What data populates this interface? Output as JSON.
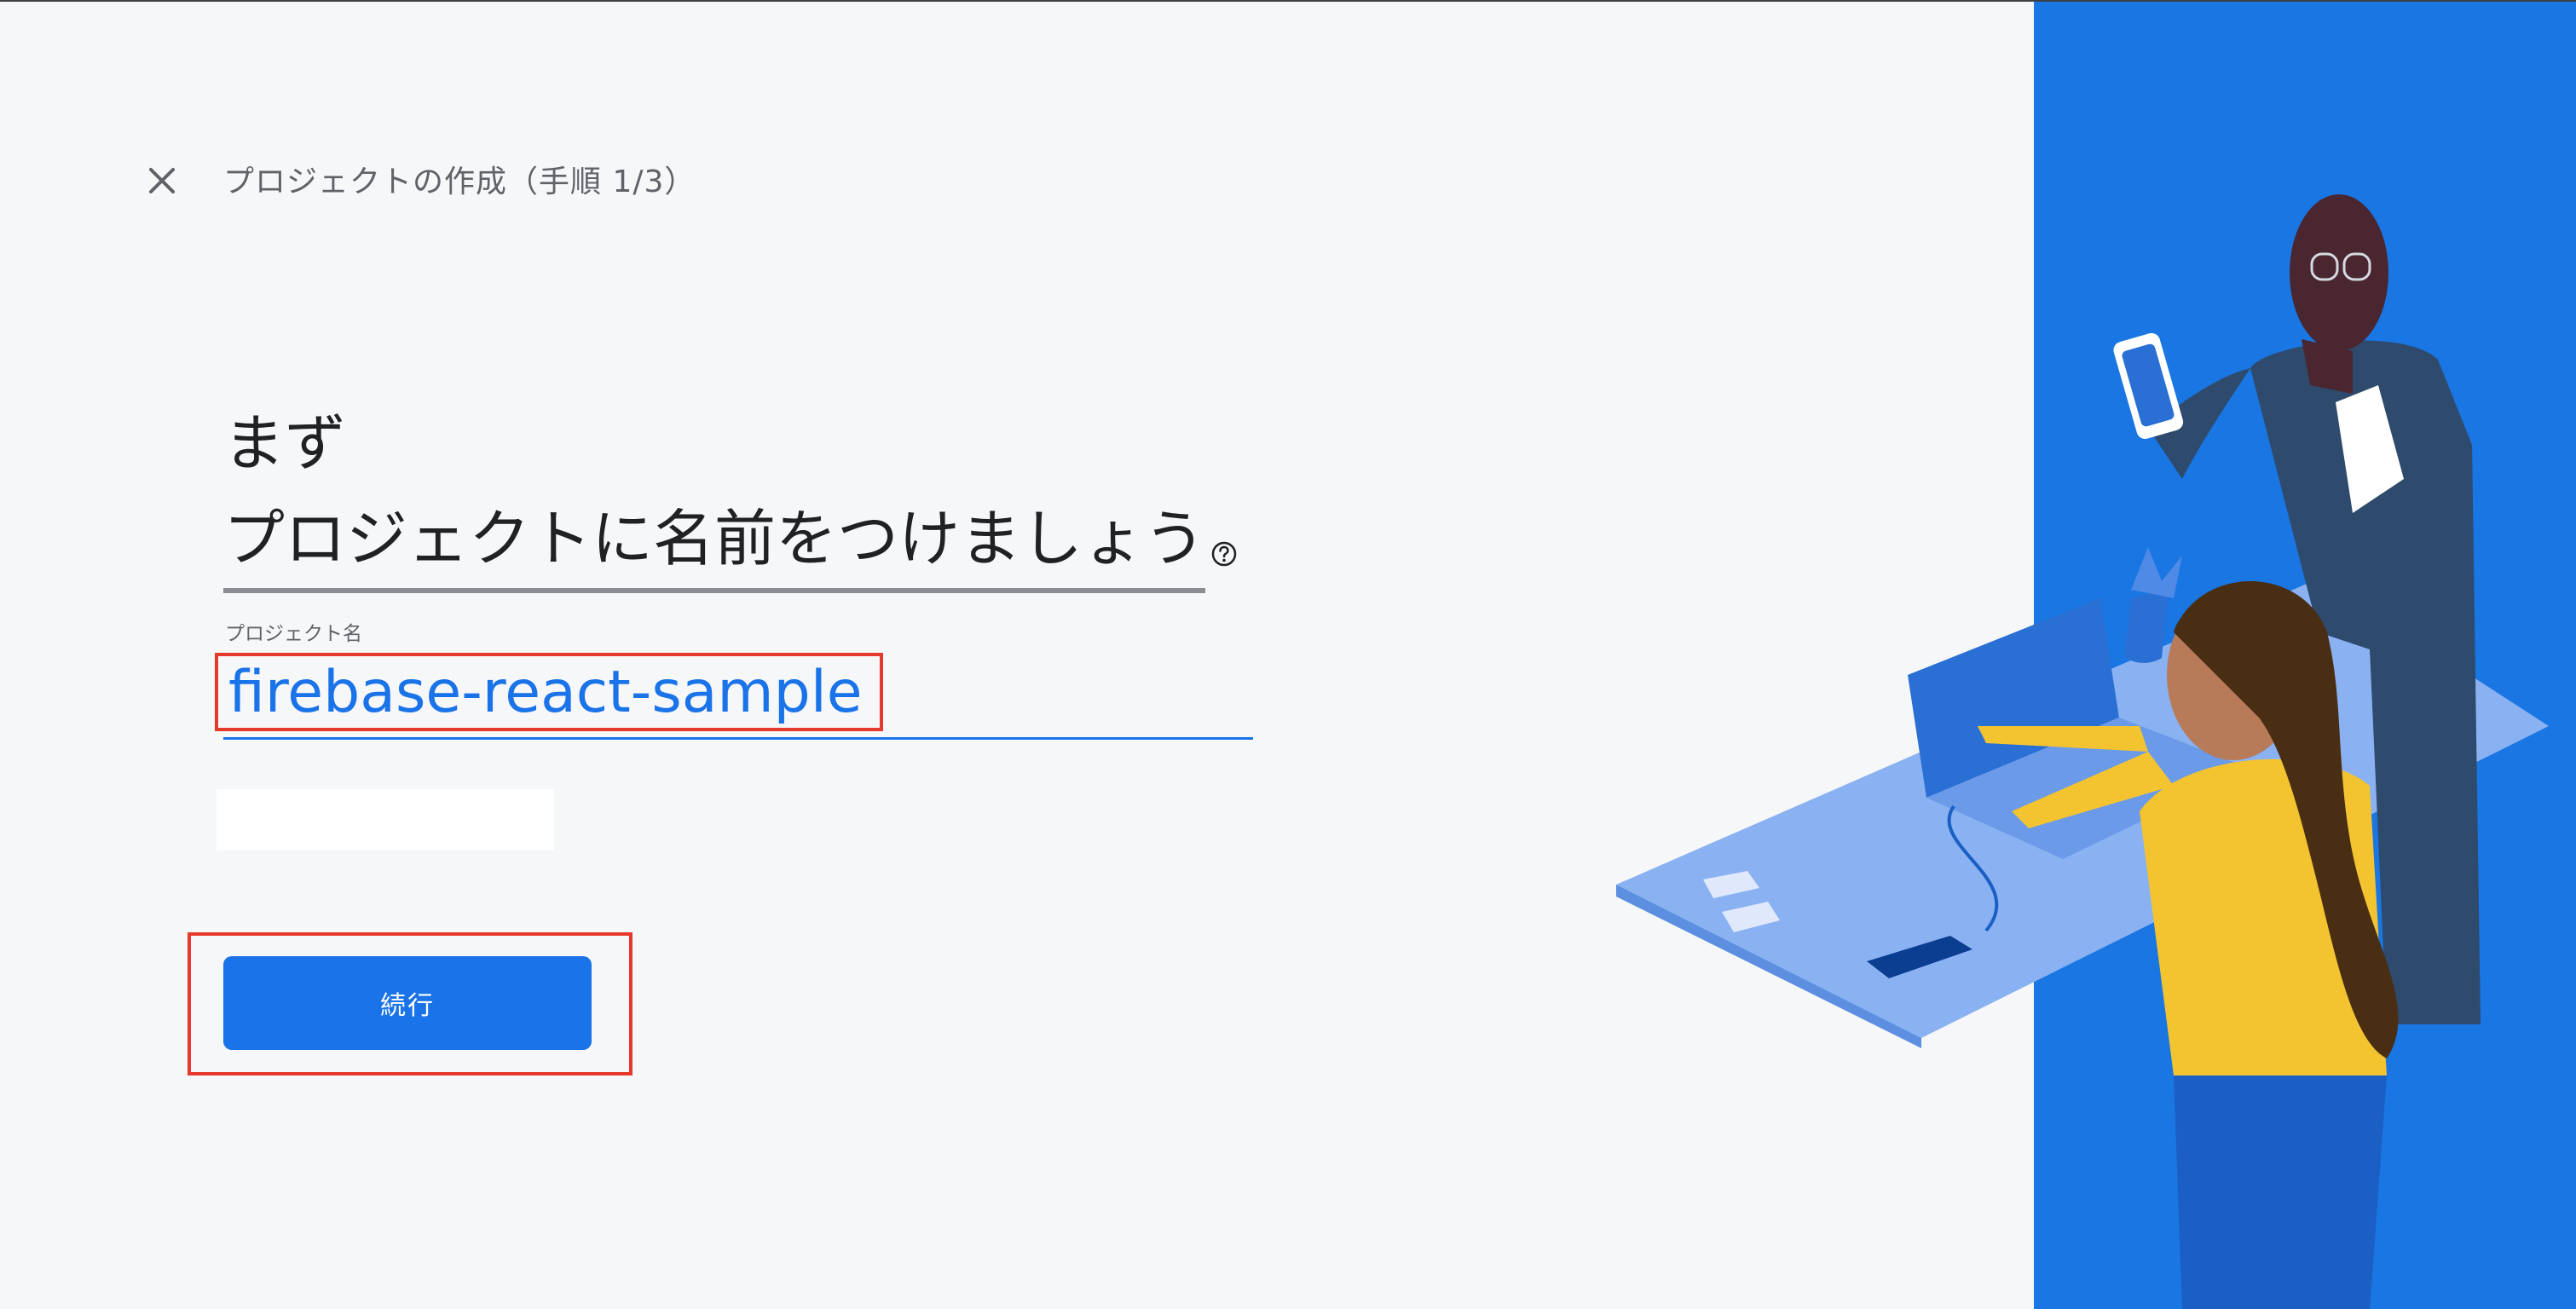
{
  "header": {
    "close_label": "×",
    "step_title": "プロジェクトの作成（手順 1/3）"
  },
  "heading": {
    "line1": "まず",
    "line2": "プロジェクトに名前をつけましょう"
  },
  "form": {
    "project_name_label": "プロジェクト名",
    "project_name_value": "firebase-react-sample"
  },
  "actions": {
    "continue_label": "続行"
  },
  "colors": {
    "accent": "#1a73e8",
    "annotation": "#e53a2b",
    "panel_blue": "#1976e2"
  },
  "icons": {
    "close": "close-icon",
    "help": "help-circle-icon"
  }
}
